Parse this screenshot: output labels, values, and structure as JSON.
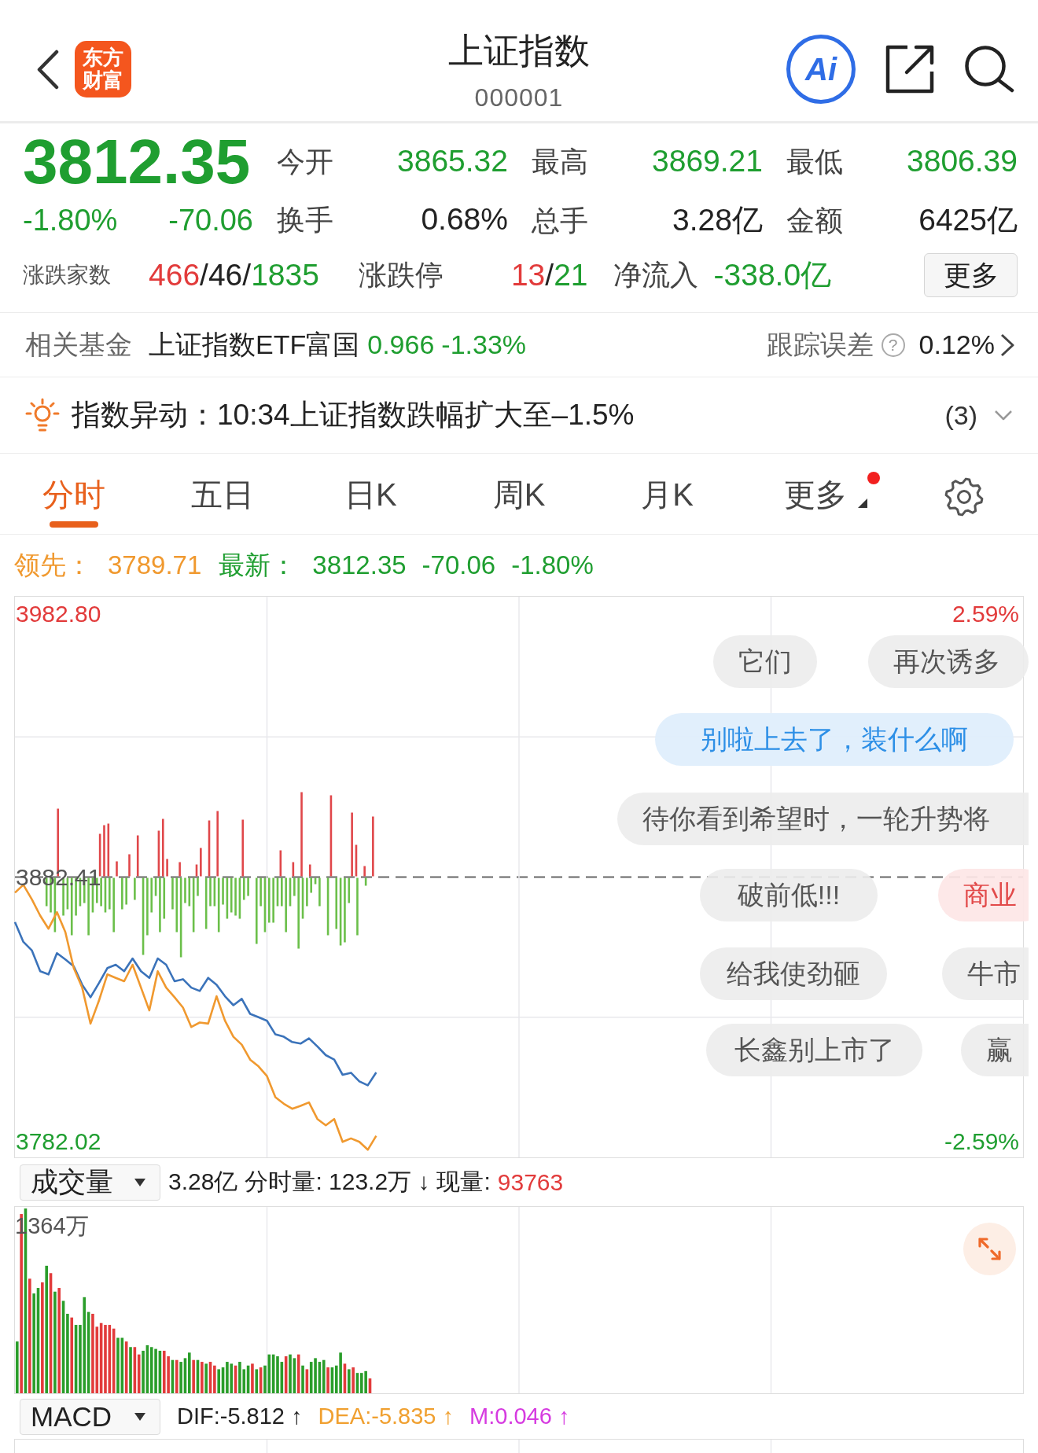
{
  "header": {
    "logo": "东方财富",
    "title": "上证指数",
    "code": "000001",
    "ai_label": "Ai"
  },
  "quote": {
    "price": "3812.35",
    "change_pct": "-1.80%",
    "change": "-70.06",
    "color": "#1f9e30",
    "stats": [
      {
        "label": "今开",
        "value": "3865.32",
        "color": "#1f9e30"
      },
      {
        "label": "最高",
        "value": "3869.21",
        "color": "#1f9e30"
      },
      {
        "label": "最低",
        "value": "3806.39",
        "color": "#1f9e30"
      },
      {
        "label": "换手",
        "value": "0.68%",
        "color": "#222222"
      },
      {
        "label": "总手",
        "value": "3.28亿",
        "color": "#222222"
      },
      {
        "label": "金额",
        "value": "6425亿",
        "color": "#222222"
      }
    ],
    "breadth": {
      "label": "涨跌家数",
      "parts": [
        {
          "text": "466",
          "color": "#e23b3b"
        },
        {
          "text": "/",
          "color": "#222222"
        },
        {
          "text": "46",
          "color": "#222222"
        },
        {
          "text": "/",
          "color": "#222222"
        },
        {
          "text": "1835",
          "color": "#1f9e30"
        }
      ]
    },
    "limits": {
      "label": "涨跌停",
      "parts": [
        {
          "text": "13",
          "color": "#e23b3b"
        },
        {
          "text": "/",
          "color": "#222222"
        },
        {
          "text": "21",
          "color": "#1f9e30"
        }
      ]
    },
    "net_inflow": {
      "label": "净流入",
      "value": "-338.0亿",
      "color": "#1f9e30"
    },
    "more_button": "更多"
  },
  "related_fund": {
    "label": "相关基金",
    "name": "上证指数ETF富国",
    "price": "0.966",
    "change": "-1.33%",
    "color": "#1f9e30",
    "tracking_label": "跟踪误差",
    "help": "?",
    "tracking_value": "0.12%"
  },
  "alert": {
    "text": "指数异动：10:34上证指数跌幅扩大至–1.5%",
    "count": "(3)"
  },
  "tabs": [
    {
      "label": "分时",
      "selected": true,
      "badge": false,
      "menu": false
    },
    {
      "label": "五日",
      "selected": false,
      "badge": false,
      "menu": false
    },
    {
      "label": "日K",
      "selected": false,
      "badge": false,
      "menu": false
    },
    {
      "label": "周K",
      "selected": false,
      "badge": false,
      "menu": false
    },
    {
      "label": "月K",
      "selected": false,
      "badge": false,
      "menu": false
    },
    {
      "label": "更多",
      "selected": false,
      "badge": true,
      "menu": true
    }
  ],
  "intraday": {
    "legend": [
      {
        "label": "领先：",
        "values": [
          "3789.71"
        ],
        "color": "#f0992f"
      },
      {
        "label": "最新：",
        "values": [
          "3812.35",
          "-70.06",
          "-1.80%"
        ],
        "color": "#1f9e30"
      }
    ],
    "chart_data": {
      "type": "line",
      "ylim": [
        3775.9,
        3989.2
      ],
      "yticks": [
        {
          "value": 3982.8,
          "label": "3982.80"
        },
        {
          "value": 3882.41,
          "label": "3882.41"
        },
        {
          "value": 3782.02,
          "label": "3782.02"
        }
      ],
      "categories": [
        null,
        null,
        null,
        null,
        null,
        null,
        null,
        null,
        null,
        null,
        null,
        null,
        null,
        null,
        null,
        null,
        null,
        null,
        null,
        null,
        null,
        null,
        null,
        null,
        null,
        null,
        null,
        null,
        null,
        null,
        null,
        null,
        null,
        null,
        null,
        null,
        null,
        null,
        null,
        null,
        null,
        null,
        null,
        null,
        null,
        null,
        null,
        null,
        null,
        null,
        null,
        null,
        null,
        null,
        null,
        null,
        null,
        null,
        null,
        null,
        null,
        null,
        null,
        null,
        null,
        null,
        null,
        null,
        null,
        null,
        null,
        null,
        null,
        null,
        null,
        null,
        null,
        null,
        null,
        null,
        null,
        null,
        null,
        null,
        null,
        null,
        null,
        null,
        null,
        null,
        null,
        null,
        null,
        null,
        null,
        null,
        null,
        null,
        null,
        null,
        null,
        null,
        null,
        null,
        null,
        null,
        null,
        null,
        null,
        null,
        null,
        null,
        null,
        null,
        null,
        null,
        null,
        null,
        null,
        null,
        null
      ],
      "series": [
        {
          "color": "#3b73ba",
          "values": [
            3865.4,
            3857.9,
            3854.7,
            3846.7,
            3845.5,
            3853.6,
            3851.2,
            3848.6,
            3841.6,
            3836.8,
            3842.2,
            3847.9,
            3849.2,
            3846.7,
            3851.6,
            3846.7,
            3844.2,
            3851.6,
            3849.2,
            3842.9,
            3843.7,
            3840.5,
            3839.2,
            3844.2,
            3841.6,
            3837.2,
            3833.8,
            3836.2,
            3830.5,
            3829.2,
            3827.9,
            3822.7,
            3821.8,
            3819.8,
            3819.2,
            3821.2,
            3818.1,
            3814.8,
            3813.1,
            3807.3,
            3808.1,
            3804.8,
            3803.3,
            3808.2,
            null,
            null,
            null,
            null,
            null,
            null,
            null,
            null,
            null,
            null,
            null,
            null,
            null,
            null,
            null,
            null,
            null,
            null,
            null,
            null,
            null,
            null,
            null,
            null,
            null,
            null,
            null,
            null,
            null,
            null,
            null,
            null,
            null,
            null,
            null,
            null,
            null,
            null,
            null,
            null,
            null,
            null,
            null,
            null,
            null,
            null,
            null,
            null,
            null,
            null,
            null,
            null,
            null,
            null,
            null,
            null,
            null,
            null,
            null,
            null,
            null,
            null,
            null,
            null,
            null,
            null,
            null,
            null,
            null,
            null,
            null,
            null,
            null,
            null,
            null,
            null,
            null
          ]
        },
        {
          "color": "#f0992f",
          "values": [
            3876.6,
            3879.6,
            3874.1,
            3867.9,
            3862.9,
            3869.2,
            3861.6,
            3847.9,
            3840.5,
            3826.8,
            3835.5,
            3845.5,
            3844.2,
            3842.9,
            3849.2,
            3840.5,
            3831.8,
            3846.7,
            3840.5,
            3836.8,
            3832.9,
            3825.5,
            3827.2,
            3826.8,
            3837.2,
            3827.9,
            3821.8,
            3818.8,
            3813.1,
            3810.5,
            3806.8,
            3798.8,
            3796.3,
            3794.4,
            3795.5,
            3796.8,
            3790.5,
            3788.1,
            3790.5,
            3781.8,
            3783.1,
            3781.8,
            3778.8,
            3784.1,
            null,
            null,
            null,
            null,
            null,
            null,
            null,
            null,
            null,
            null,
            null,
            null,
            null,
            null,
            null,
            null,
            null,
            null,
            null,
            null,
            null,
            null,
            null,
            null,
            null,
            null,
            null,
            null,
            null,
            null,
            null,
            null,
            null,
            null,
            null,
            null,
            null,
            null,
            null,
            null,
            null,
            null,
            null,
            null,
            null,
            null,
            null,
            null,
            null,
            null,
            null,
            null,
            null,
            null,
            null,
            null,
            null,
            null,
            null,
            null,
            null,
            null,
            null,
            null,
            null,
            null,
            null,
            null,
            null,
            null,
            null,
            null,
            null,
            null,
            null,
            null,
            null
          ]
        }
      ]
    },
    "pct_scale": [
      "2.59%",
      "-2.59%"
    ],
    "comments": [
      {
        "text": "它们",
        "kind": "plain"
      },
      {
        "text": "再次诱多",
        "kind": "plain"
      },
      {
        "text": "别啦上去了，装什么啊",
        "kind": "featured"
      },
      {
        "text": "待你看到希望时，一轮升势将",
        "kind": "plain"
      },
      {
        "text": "破前低!!!",
        "kind": "plain"
      },
      {
        "text": "商业",
        "kind": "hot"
      },
      {
        "text": "给我使劲砸",
        "kind": "plain"
      },
      {
        "text": "牛市",
        "kind": "plain"
      },
      {
        "text": "长鑫别上市了",
        "kind": "plain"
      },
      {
        "text": "赢",
        "kind": "plain"
      }
    ]
  },
  "volume": {
    "indicator": "成交量",
    "total": "3.28亿",
    "minute_volume": "分时量: 123.2万 ↓",
    "current_label": "现量:",
    "current_value": "93763",
    "scale_max": "1364万"
  },
  "macd": {
    "indicator": "MACD",
    "values": [
      {
        "text": "DIF:-5.812 ↑",
        "color": "#222222"
      },
      {
        "text": "DEA:-5.835 ↑",
        "color": "#f0a030"
      },
      {
        "text": "M:0.046 ↑",
        "color": "#d63be0"
      }
    ]
  }
}
